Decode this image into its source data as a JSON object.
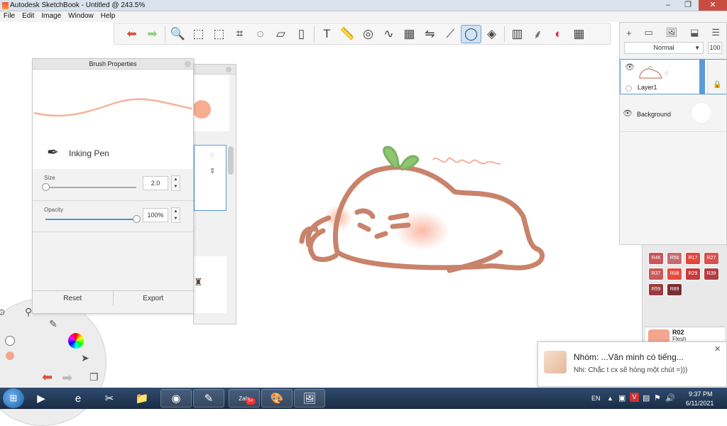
{
  "window": {
    "title": "Autodesk SketchBook - Untitled @ 243.5%",
    "minimize": "–",
    "maximize": "❐",
    "close": "✕"
  },
  "menu": [
    "File",
    "Edit",
    "Image",
    "Window",
    "Help"
  ],
  "toolbar": {
    "icons": [
      "undo-icon",
      "redo-icon",
      "zoom-icon",
      "select-icon",
      "transform-icon",
      "crop-icon",
      "lasso-icon",
      "distort-icon",
      "fill-icon",
      "text-icon",
      "ruler-icon",
      "ellipse-icon",
      "french-curve-icon",
      "perspective-icon",
      "symmetry-icon",
      "stroke-icon",
      "predictive-stroke-icon",
      "shape-icon",
      "copic-library-icon",
      "brush-library-icon",
      "color-wheel-icon",
      "palette-icon"
    ],
    "glyphs": [
      "⬅",
      "➡",
      "🔍",
      "⬚",
      "⬚",
      "⌗",
      "◌",
      "▱",
      "▯",
      "T",
      "📏",
      "◎",
      "∿",
      "▦",
      "⇋",
      "⟋",
      "◯",
      "◈",
      "▥",
      "⸙",
      "◐",
      "▦"
    ],
    "active_index": 16
  },
  "layers": {
    "tool_glyphs": [
      "+",
      "▭",
      "🖼",
      "⬓",
      "☰"
    ],
    "blend_mode": "Normal",
    "opacity": "100",
    "items": [
      {
        "name": "Layer1",
        "selected": true
      },
      {
        "name": "Background",
        "selected": false
      }
    ]
  },
  "brush_properties": {
    "title": "Brush Properties",
    "brush_name": "Inking Pen",
    "size_label": "Size",
    "size_value": "2.0",
    "opacity_label": "Opacity",
    "opacity_value": "100%",
    "opacity_level": 1.0,
    "size_level": 0.0,
    "reset_label": "Reset",
    "export_label": "Export"
  },
  "copic": {
    "swatches": [
      {
        "code": "R46",
        "color": "#c8555a"
      },
      {
        "code": "R56",
        "color": "#c66b72"
      },
      {
        "code": "R17",
        "color": "#e0473d"
      },
      {
        "code": "R27",
        "color": "#d7524d"
      },
      {
        "code": "R37",
        "color": "#c95a5a"
      },
      {
        "code": "R08",
        "color": "#e84c3d"
      },
      {
        "code": "R29",
        "color": "#c63b3b"
      },
      {
        "code": "R39",
        "color": "#b23d44"
      },
      {
        "code": "R59",
        "color": "#9c3b40"
      },
      {
        "code": "R89",
        "color": "#7c2d33"
      }
    ],
    "selected_code": "R02",
    "selected_name": "Flesh",
    "selected_color": "#f3a68e"
  },
  "notification": {
    "title": "Nhóm: ...Văn minh có tiếng...",
    "message": "Nhi: Chắc t cx sẽ hóng một chút =)))",
    "close": "✕"
  },
  "taskbar": {
    "start": "start-orb",
    "apps": [
      "media-player-icon",
      "internet-explorer-icon",
      "snipping-tool-icon",
      "file-explorer-icon",
      "chrome-icon",
      "sketchbook-icon",
      "zalo-icon",
      "paint-icon",
      "photo-viewer-icon"
    ],
    "glyphs": [
      "▶",
      "e",
      "✂",
      "📁",
      "◉",
      "✎",
      "Zalo",
      "🎨",
      "🖼"
    ],
    "zalo_badge": "5+",
    "lang": "EN",
    "time": "9:37 PM",
    "date": "6/11/2021"
  },
  "colors": {
    "accent": "#5a9bd6",
    "stroke": "#c8836a",
    "brush_preview": "#f3b49a",
    "leaf": "#8cc670"
  }
}
